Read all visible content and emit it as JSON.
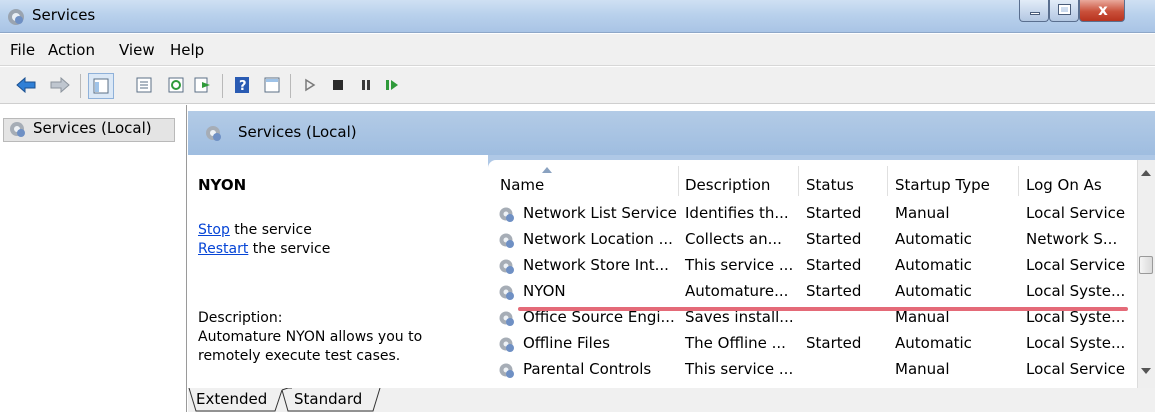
{
  "window": {
    "title": "Services",
    "close_glyph": "x",
    "colors": {
      "title_bar": "#b9d1ec",
      "header_band": "#a9c4e5",
      "link": "#0645d6",
      "highlight_line": "#e46a78"
    }
  },
  "menu": [
    "File",
    "Action",
    "View",
    "Help"
  ],
  "toolbar": {
    "icons": [
      "back-arrow-icon",
      "forward-arrow-icon",
      "show-hide-tree-icon",
      "properties-icon",
      "refresh-icon",
      "export-list-icon",
      "help-icon",
      "extended-view-icon",
      "start-service-icon",
      "stop-service-icon",
      "pause-service-icon",
      "resume-service-icon"
    ]
  },
  "tree": {
    "root": "Services (Local)"
  },
  "header": {
    "title": "Services (Local)"
  },
  "details": {
    "service_name": "NYON",
    "stop_link": "Stop",
    "stop_suffix": " the service",
    "restart_link": "Restart",
    "restart_suffix": " the service",
    "description_label": "Description:",
    "description": "Automature NYON allows you to remotely execute test cases."
  },
  "columns": [
    "Name",
    "Description",
    "Status",
    "Startup Type",
    "Log On As"
  ],
  "rows": [
    {
      "name": "Network List Service",
      "description": "Identifies th...",
      "status": "Started",
      "startup": "Manual",
      "logon": "Local Service"
    },
    {
      "name": "Network Location ...",
      "description": "Collects an...",
      "status": "Started",
      "startup": "Automatic",
      "logon": "Network S..."
    },
    {
      "name": "Network Store Int...",
      "description": "This service ...",
      "status": "Started",
      "startup": "Automatic",
      "logon": "Local Service"
    },
    {
      "name": "NYON",
      "description": "Automature...",
      "status": "Started",
      "startup": "Automatic",
      "logon": "Local Syste..."
    },
    {
      "name": "Office Source Engi...",
      "description": "Saves install...",
      "status": "",
      "startup": "Manual",
      "logon": "Local Syste..."
    },
    {
      "name": "Offline Files",
      "description": "The Offline ...",
      "status": "Started",
      "startup": "Automatic",
      "logon": "Local Syste..."
    },
    {
      "name": "Parental Controls",
      "description": "This service ...",
      "status": "",
      "startup": "Manual",
      "logon": "Local Service"
    }
  ],
  "tabs": [
    "Extended",
    "Standard"
  ]
}
